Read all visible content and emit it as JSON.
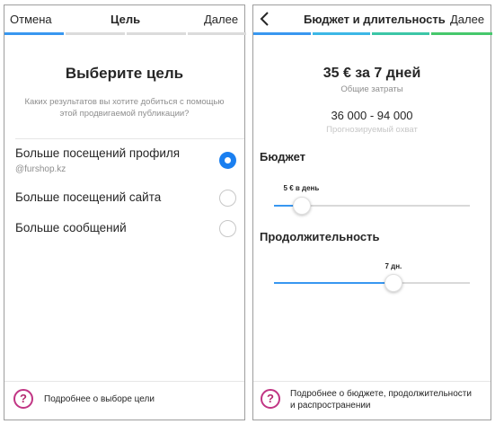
{
  "left": {
    "header": {
      "cancel": "Отмена",
      "title": "Цель",
      "next": "Далее"
    },
    "progress_colors": [
      "#3897f0",
      "#dbdbdb",
      "#dbdbdb",
      "#dbdbdb"
    ],
    "heading": "Выберите цель",
    "subtitle_line1": "Каких результатов вы хотите добиться с помощью",
    "subtitle_line2": "этой продвигаемой публикации?",
    "options": [
      {
        "label": "Больше посещений профиля",
        "sub": "@furshop.kz",
        "selected": true
      },
      {
        "label": "Больше посещений сайта",
        "selected": false
      },
      {
        "label": "Больше сообщений",
        "selected": false
      }
    ],
    "help_icon": "?",
    "help_text": "Подробнее о выборе цели"
  },
  "right": {
    "header": {
      "back_icon": "chevron-left",
      "title": "Бюджет и длительность",
      "next": "Далее"
    },
    "progress_colors": [
      "#3897f0",
      "#3cb7e6",
      "#3cc6a7",
      "#46c86c"
    ],
    "total": "35 € за 7 дней",
    "total_label": "Общие затраты",
    "reach": "36 000 - 94 000",
    "reach_label": "Прогнозируемый охват",
    "budget_title": "Бюджет",
    "budget_value": "5 € в день",
    "budget_fraction": 0.14,
    "duration_title": "Продолжительность",
    "duration_value": "7 дн.",
    "duration_fraction": 0.61,
    "help_icon": "?",
    "help_line1": "Подробнее о бюджете, продолжительности",
    "help_line2": "и распространении"
  }
}
